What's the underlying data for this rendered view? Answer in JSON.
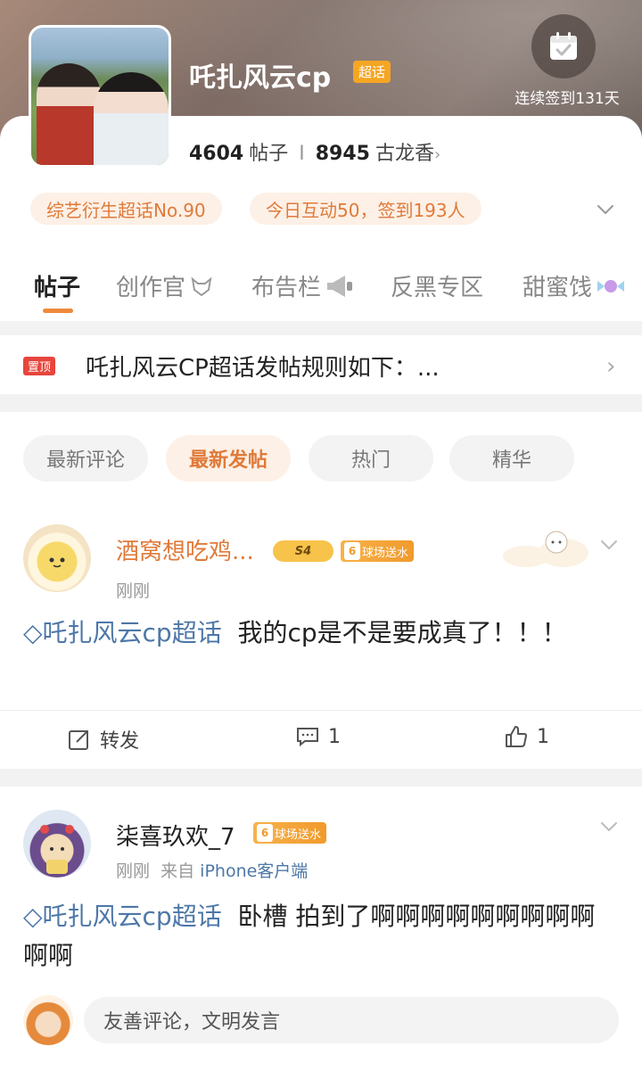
{
  "header": {
    "title": "吒扎风云cp",
    "tag": "超话",
    "sign_days": "连续签到131天",
    "posts_count": "4604",
    "posts_label": "帖子",
    "fans_count": "8945",
    "fans_label": "古龙香",
    "rank_pill": "综艺衍生超话No.90",
    "today_pill": "今日互动50，签到193人"
  },
  "tabs": [
    "帖子",
    "创作官",
    "布告栏",
    "反黑专区",
    "甜蜜饯"
  ],
  "pinned": {
    "badge": "置顶",
    "text": "吒扎风云CP超话发帖规则如下：..."
  },
  "filters": [
    "最新评论",
    "最新发帖",
    "热门",
    "精华"
  ],
  "posts": [
    {
      "user": "酒窝想吃鸡...",
      "vip": "S4",
      "water_level": "6",
      "water_label": "球场送水",
      "time": "刚刚",
      "source": "",
      "topic": "◇吒扎风云cp超话",
      "text": "我的cp是不是要成真了！！！",
      "repost": "转发",
      "comments": "1",
      "likes": "1"
    },
    {
      "user": "柒喜玖欢_7",
      "water_level": "6",
      "water_label": "球场送水",
      "time": "刚刚",
      "source_prefix": "来自",
      "source": "iPhone客户端",
      "topic": "◇吒扎风云cp超话",
      "text": "卧槽  拍到了啊啊啊啊啊啊啊啊啊啊啊",
      "comment_placeholder": "友善评论，文明发言"
    }
  ],
  "colors": {
    "accent": "#e07a3a",
    "link": "#4d77a8",
    "pin": "#e8453c"
  }
}
